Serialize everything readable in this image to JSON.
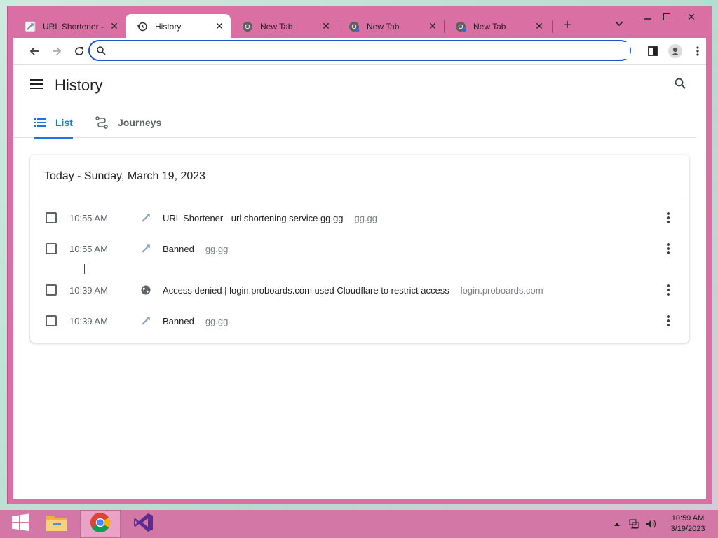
{
  "browser": {
    "tabs": [
      {
        "title": "URL Shortener -",
        "icon": "url-shortener-favicon",
        "active": false
      },
      {
        "title": "History",
        "icon": "history-icon",
        "active": true
      },
      {
        "title": "New Tab",
        "icon": "chrome-icon",
        "active": false
      },
      {
        "title": "New Tab",
        "icon": "chrome-icon",
        "active": false
      },
      {
        "title": "New Tab",
        "icon": "chrome-icon",
        "active": false
      }
    ],
    "omnibox": {
      "value": "",
      "placeholder": ""
    }
  },
  "history": {
    "title": "History",
    "tabs": {
      "list": "List",
      "journeys": "Journeys"
    },
    "day_header": "Today - Sunday, March 19, 2023",
    "entries": [
      {
        "time": "10:55 AM",
        "title": "URL Shortener - url shortening service gg.gg",
        "domain": "gg.gg",
        "icon": "url-shortener-favicon"
      },
      {
        "time": "10:55 AM",
        "title": "Banned",
        "domain": "gg.gg",
        "icon": "url-shortener-favicon"
      },
      {
        "time": "10:39 AM",
        "title": "Access denied | login.proboards.com used Cloudflare to restrict access",
        "domain": "login.proboards.com",
        "icon": "globe-icon"
      },
      {
        "time": "10:39 AM",
        "title": "Banned",
        "domain": "gg.gg",
        "icon": "url-shortener-favicon"
      }
    ]
  },
  "taskbar": {
    "clock_time": "10:59 AM",
    "clock_date": "3/19/2023"
  },
  "colors": {
    "window_frame": "#d96fa3",
    "accent": "#1a73e8",
    "omnibox_border": "#1a56c4",
    "taskbar": "#d277a6"
  }
}
